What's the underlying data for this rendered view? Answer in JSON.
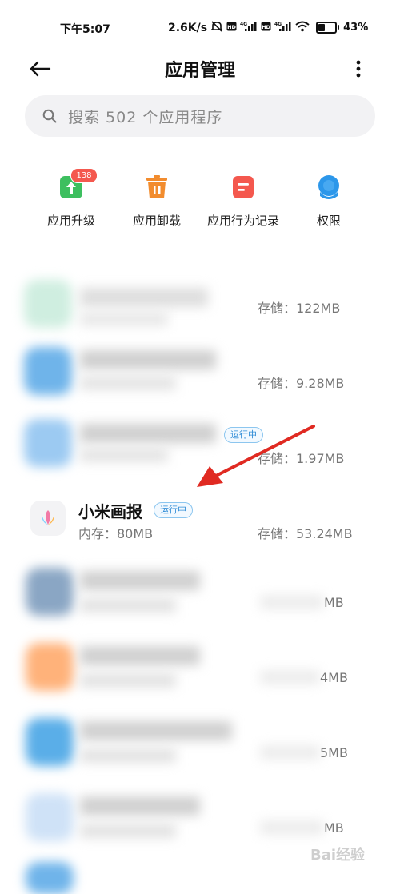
{
  "status_bar": {
    "time": "下午5:07",
    "speed": "2.6K/s",
    "battery_percent": 43,
    "battery_label": "43%",
    "icons": [
      "mute-icon",
      "hd-icon",
      "signal-4g-icon",
      "hd-icon",
      "signal-4g-icon",
      "wifi-icon",
      "battery-icon"
    ]
  },
  "header": {
    "title": "应用管理",
    "back_icon": "arrow-left-icon",
    "more_icon": "more-vertical-icon"
  },
  "search": {
    "placeholder": "搜索 502 个应用程序",
    "icon": "search-icon"
  },
  "tools": [
    {
      "label": "应用升级",
      "icon": "upgrade-icon",
      "color": "#3dbf5f",
      "badge": "138"
    },
    {
      "label": "应用卸载",
      "icon": "trash-icon",
      "color": "#f28c2e"
    },
    {
      "label": "应用行为记录",
      "icon": "document-icon",
      "color": "#f4584e"
    },
    {
      "label": "权限",
      "icon": "shield-icon",
      "color": "#2c97ea"
    }
  ],
  "apps": [
    {
      "storage": "存储：122MB",
      "blurred": true
    },
    {
      "storage": "存储：9.28MB",
      "blurred": true
    },
    {
      "storage": "存储：1.97MB",
      "blurred": true,
      "running": "运行中"
    },
    {
      "name": "小米画报",
      "memory": "内存：80MB",
      "storage": "存储：53.24MB",
      "running": "运行中",
      "blurred": false,
      "icon": "tulip-icon"
    },
    {
      "storage_partial": "MB",
      "blurred": true
    },
    {
      "storage_partial": "4MB",
      "blurred": true
    },
    {
      "storage_partial": "5MB",
      "blurred": true
    },
    {
      "storage_partial": "MB",
      "blurred": true
    }
  ],
  "accent_colors": {
    "running_badge": "#2e8bd6",
    "arrow": "#e02a22"
  },
  "watermark": "Bai经验"
}
